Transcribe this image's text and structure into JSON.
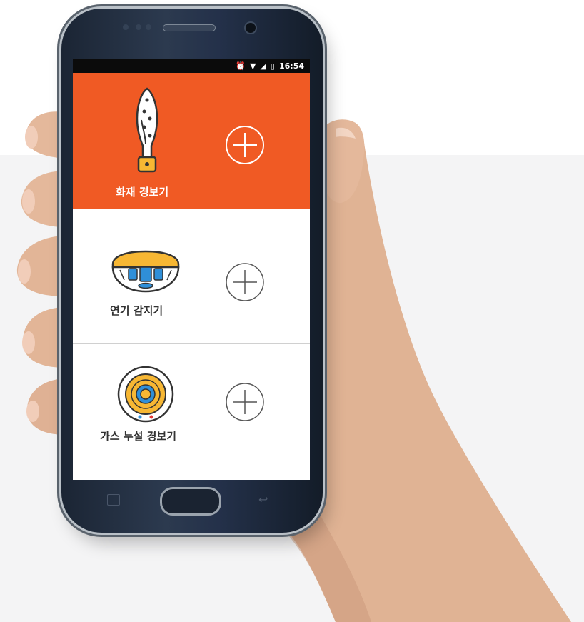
{
  "status_bar": {
    "alarm_icon": "alarm-clock-icon",
    "wifi_icon": "wifi-icon",
    "signal_icon": "signal-icon",
    "battery_icon": "battery-icon",
    "time": "16:54"
  },
  "devices": [
    {
      "label": "화재 경보기",
      "icon": "fire-alarm-icon",
      "add_icon": "plus-circle-icon"
    },
    {
      "label": "연기 감지기",
      "icon": "smoke-detector-icon",
      "add_icon": "plus-circle-icon"
    },
    {
      "label": "가스 누설 경보기",
      "icon": "gas-leak-alarm-icon",
      "add_icon": "plus-circle-icon"
    }
  ],
  "colors": {
    "accent": "#f05a24",
    "background": "#f4f4f5",
    "phone_body": "#1f2a3a",
    "icon_yellow": "#f7b733",
    "icon_blue": "#2f8fd8"
  }
}
